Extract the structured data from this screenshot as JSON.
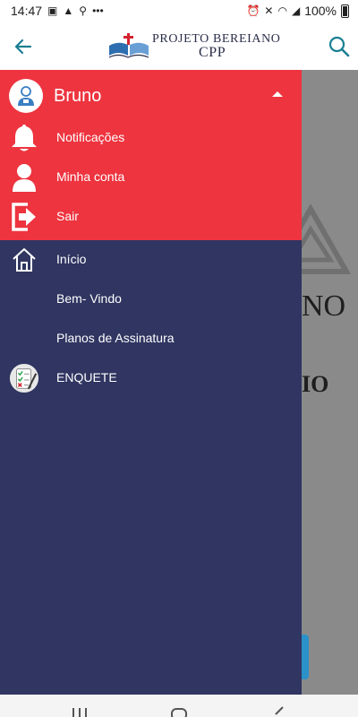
{
  "status_bar": {
    "time": "14:47",
    "more": "•••",
    "battery": "100%"
  },
  "app_bar": {
    "logo_line1": "PROJETO BEREIANO",
    "logo_line2": "CPP"
  },
  "drawer": {
    "username": "Bruno",
    "account_items": [
      {
        "label": "Notificações",
        "icon": "bell-icon"
      },
      {
        "label": "Minha conta",
        "icon": "person-icon"
      },
      {
        "label": "Sair",
        "icon": "logout-icon"
      }
    ],
    "menu_items": [
      {
        "label": "Início",
        "icon": "home-icon"
      },
      {
        "label": "Bem- Vindo"
      },
      {
        "label": "Planos de Assinatura"
      },
      {
        "label": "ENQUETE",
        "icon": "survey-icon"
      }
    ]
  },
  "background": {
    "text1": "NO",
    "text2": "IO"
  },
  "colors": {
    "header_red": "#ed343f",
    "drawer_navy": "#303561",
    "accent_teal": "#1a7f93"
  }
}
